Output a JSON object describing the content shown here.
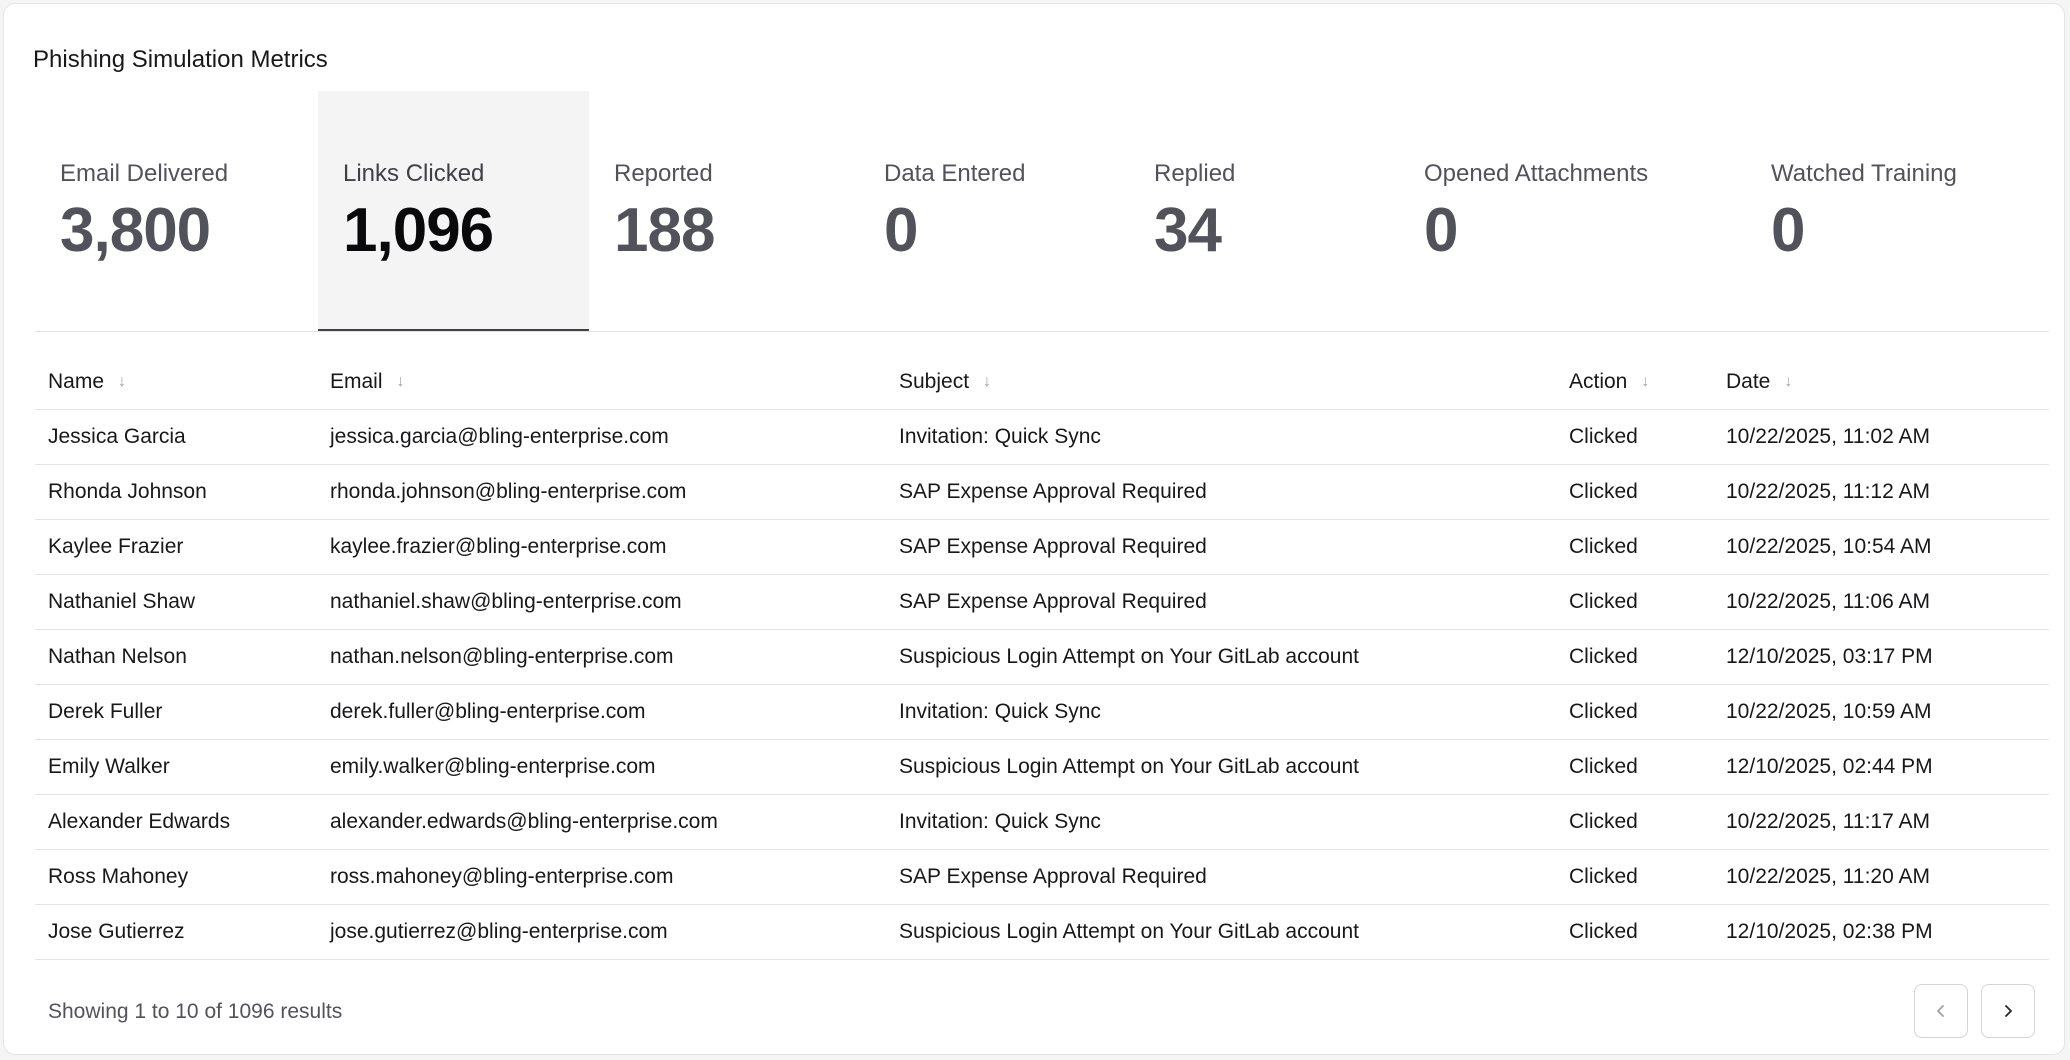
{
  "card": {
    "title": "Phishing Simulation Metrics"
  },
  "metrics": [
    {
      "label": "Email Delivered",
      "value": "3,800"
    },
    {
      "label": "Links Clicked",
      "value": "1,096",
      "active": true
    },
    {
      "label": "Reported",
      "value": "188"
    },
    {
      "label": "Data Entered",
      "value": "0"
    },
    {
      "label": "Replied",
      "value": "34"
    },
    {
      "label": "Opened Attachments",
      "value": "0"
    },
    {
      "label": "Watched Training",
      "value": "0"
    }
  ],
  "table": {
    "columns": [
      "Name",
      "Email",
      "Subject",
      "Action",
      "Date"
    ],
    "sort_icon": "arrow-down-icon",
    "rows": [
      {
        "name": "Jessica Garcia",
        "email": "jessica.garcia@bling-enterprise.com",
        "subject": "Invitation: Quick Sync",
        "action": "Clicked",
        "date": "10/22/2025, 11:02 AM"
      },
      {
        "name": "Rhonda Johnson",
        "email": "rhonda.johnson@bling-enterprise.com",
        "subject": "SAP Expense Approval Required",
        "action": "Clicked",
        "date": "10/22/2025, 11:12 AM"
      },
      {
        "name": "Kaylee Frazier",
        "email": "kaylee.frazier@bling-enterprise.com",
        "subject": "SAP Expense Approval Required",
        "action": "Clicked",
        "date": "10/22/2025, 10:54 AM"
      },
      {
        "name": "Nathaniel Shaw",
        "email": "nathaniel.shaw@bling-enterprise.com",
        "subject": "SAP Expense Approval Required",
        "action": "Clicked",
        "date": "10/22/2025, 11:06 AM"
      },
      {
        "name": "Nathan Nelson",
        "email": "nathan.nelson@bling-enterprise.com",
        "subject": "Suspicious Login Attempt on Your GitLab account",
        "action": "Clicked",
        "date": "12/10/2025, 03:17 PM"
      },
      {
        "name": "Derek Fuller",
        "email": "derek.fuller@bling-enterprise.com",
        "subject": "Invitation: Quick Sync",
        "action": "Clicked",
        "date": "10/22/2025, 10:59 AM"
      },
      {
        "name": "Emily Walker",
        "email": "emily.walker@bling-enterprise.com",
        "subject": "Suspicious Login Attempt on Your GitLab account",
        "action": "Clicked",
        "date": "12/10/2025, 02:44 PM"
      },
      {
        "name": "Alexander Edwards",
        "email": "alexander.edwards@bling-enterprise.com",
        "subject": "Invitation: Quick Sync",
        "action": "Clicked",
        "date": "10/22/2025, 11:17 AM"
      },
      {
        "name": "Ross Mahoney",
        "email": "ross.mahoney@bling-enterprise.com",
        "subject": "SAP Expense Approval Required",
        "action": "Clicked",
        "date": "10/22/2025, 11:20 AM"
      },
      {
        "name": "Jose Gutierrez",
        "email": "jose.gutierrez@bling-enterprise.com",
        "subject": "Suspicious Login Attempt on Your GitLab account",
        "action": "Clicked",
        "date": "12/10/2025, 02:38 PM"
      }
    ]
  },
  "pagination": {
    "summary": "Showing 1 to 10 of 1096 results",
    "prev_icon": "chevron-left-icon",
    "next_icon": "chevron-right-icon"
  },
  "colors": {
    "active_tab_bg": "#f4f4f5",
    "active_tab_underline": "#3f3f46",
    "border": "#e4e4e7"
  }
}
